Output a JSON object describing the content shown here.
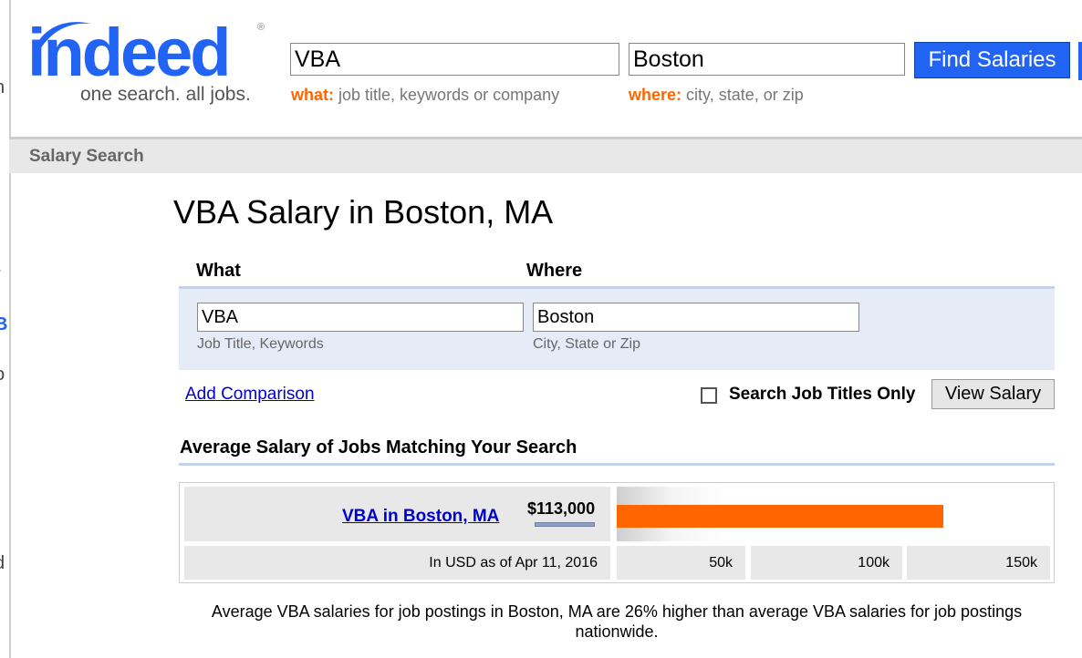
{
  "logo": {
    "word": "indeed",
    "registered": "®",
    "tagline": "one search. all jobs."
  },
  "header": {
    "what_value": "VBA",
    "where_value": "Boston",
    "what_label": "what:",
    "what_hint": "job title, keywords or company",
    "where_label": "where:",
    "where_hint": "city, state, or zip",
    "find_button": "Find Salaries"
  },
  "subbar": {
    "title": "Salary Search"
  },
  "page": {
    "title": "VBA Salary in Boston, MA"
  },
  "form": {
    "what_label": "What",
    "where_label": "Where",
    "what_value": "VBA",
    "where_value": "Boston",
    "what_hint": "Job Title, Keywords",
    "where_hint": "City, State or Zip",
    "add_comparison": "Add Comparison",
    "titles_only_label": "Search Job Titles Only",
    "titles_only_checked": false,
    "view_salary": "View Salary"
  },
  "results": {
    "section_title": "Average Salary of Jobs Matching Your Search",
    "job_link": "VBA in Boston, MA",
    "salary": "$113,000",
    "salary_value": 113000,
    "scale_max": 150000,
    "bar_color": "#ff6600",
    "currency_note": "In USD as of Apr 11, 2016",
    "ticks": [
      "50k",
      "100k",
      "150k"
    ]
  },
  "summary": "Average VBA salaries for job postings in Boston, MA are 26% higher than average VBA salaries for job postings nationwide."
}
